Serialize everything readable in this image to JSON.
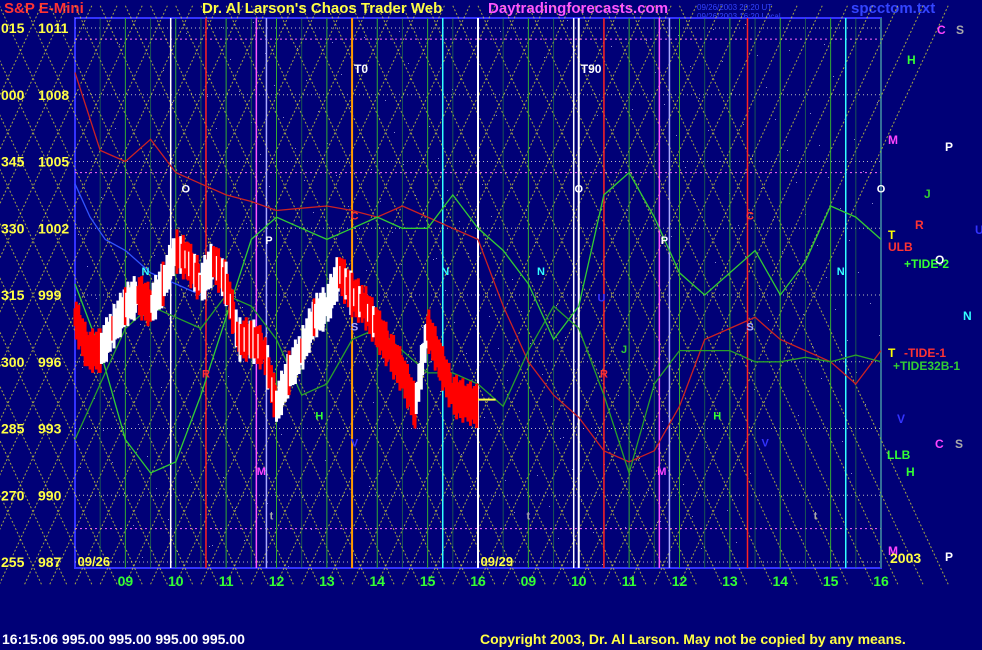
{
  "header": {
    "title": "S&P E-Mini",
    "subtitle": "Dr. Al Larson's Chaos Trader Web",
    "site": "Daytradingforecasts.com",
    "gen_line1": "09/26/2003 20:20 UT",
    "gen_line2": "09/26/2003 16:20 Local",
    "file": "spcctom.txt"
  },
  "status": {
    "last": "16:15:06  995.00 995.00 995.00 995.00",
    "copyright": "Copyright 2003, Dr. Al Larson. May not be copied by any means."
  },
  "colors": {
    "background": "#000077",
    "plot_border": "#3333ff",
    "grid_v": "#33aa33",
    "diag": "#dddd33",
    "price_up": "#ffffff",
    "price_down": "#ff0000",
    "tide": "#33cc33",
    "red_line": "#cc2222"
  },
  "chart_data": {
    "type": "line",
    "title": "S&P E-Mini",
    "ylim": [
      987,
      1011
    ],
    "y_ticks": [
      {
        "angle": "015",
        "price": "1011",
        "value": 1011
      },
      {
        "angle": "000",
        "price": "1008",
        "value": 1008
      },
      {
        "angle": "345",
        "price": "1005",
        "value": 1005
      },
      {
        "angle": "330",
        "price": "1002",
        "value": 1002
      },
      {
        "angle": "315",
        "price": "999",
        "value": 999
      },
      {
        "angle": "300",
        "price": "996",
        "value": 996
      },
      {
        "angle": "285",
        "price": "993",
        "value": 993
      },
      {
        "angle": "270",
        "price": "990",
        "value": 990
      },
      {
        "angle": "255",
        "price": "987",
        "value": 987
      }
    ],
    "dates": [
      "09/26",
      "09/29"
    ],
    "year": "2003",
    "hour_ticks": [
      {
        "label": "09",
        "x": 9.0
      },
      {
        "label": "10",
        "x": 10.0
      },
      {
        "label": "11",
        "x": 11.0
      },
      {
        "label": "12",
        "x": 12.0
      },
      {
        "label": "13",
        "x": 13.0
      },
      {
        "label": "14",
        "x": 14.0
      },
      {
        "label": "15",
        "x": 15.0
      },
      {
        "label": "16",
        "x": 16.0
      },
      {
        "label": "09",
        "x": 17.0
      },
      {
        "label": "10",
        "x": 18.0
      },
      {
        "label": "11",
        "x": 19.0
      },
      {
        "label": "12",
        "x": 20.0
      },
      {
        "label": "13",
        "x": 21.0
      },
      {
        "label": "14",
        "x": 22.0
      },
      {
        "label": "15",
        "x": 23.0
      },
      {
        "label": "16",
        "x": 24.0
      }
    ],
    "xlim": [
      8.0,
      24.0
    ],
    "special_lines": [
      {
        "label": "T0",
        "x": 13.5,
        "color": "#ff9900"
      },
      {
        "label": "T90",
        "x": 18.0,
        "color": "#ffffff"
      }
    ],
    "markers": [
      {
        "t": "O",
        "x": 10.2,
        "y": 1003.6,
        "c": "#ffffff"
      },
      {
        "t": "O",
        "x": 18.0,
        "y": 1003.6,
        "c": "#ffffff"
      },
      {
        "t": "O",
        "x": 24.0,
        "y": 1003.6,
        "c": "#ffffff"
      },
      {
        "t": "N",
        "x": 9.4,
        "y": 999.9,
        "c": "#33ffff"
      },
      {
        "t": "N",
        "x": 15.35,
        "y": 999.9,
        "c": "#33ffff"
      },
      {
        "t": "N",
        "x": 17.25,
        "y": 999.9,
        "c": "#33ffff"
      },
      {
        "t": "N",
        "x": 23.2,
        "y": 999.9,
        "c": "#33ffff"
      },
      {
        "t": "P",
        "x": 11.85,
        "y": 1001.3,
        "c": "#ffffff"
      },
      {
        "t": "P",
        "x": 19.7,
        "y": 1001.3,
        "c": "#ffffff"
      },
      {
        "t": "C",
        "x": 13.55,
        "y": 1002.4,
        "c": "#ff3333"
      },
      {
        "t": "C",
        "x": 21.4,
        "y": 1002.4,
        "c": "#ff3333"
      },
      {
        "t": "S",
        "x": 13.55,
        "y": 997.4,
        "c": "#aaaaff"
      },
      {
        "t": "S",
        "x": 21.4,
        "y": 997.4,
        "c": "#aaaaff"
      },
      {
        "t": "H",
        "x": 12.85,
        "y": 993.4,
        "c": "#33ff33"
      },
      {
        "t": "H",
        "x": 20.75,
        "y": 993.4,
        "c": "#33ff33"
      },
      {
        "t": "M",
        "x": 11.7,
        "y": 990.9,
        "c": "#ff44ff"
      },
      {
        "t": "M",
        "x": 19.65,
        "y": 990.9,
        "c": "#ff44ff"
      },
      {
        "t": "t",
        "x": 11.9,
        "y": 988.9,
        "c": "#aaaaaa"
      },
      {
        "t": "t",
        "x": 17.0,
        "y": 988.9,
        "c": "#aaaaaa"
      },
      {
        "t": "t",
        "x": 22.7,
        "y": 988.9,
        "c": "#aaaaaa"
      },
      {
        "t": "V",
        "x": 13.55,
        "y": 992.2,
        "c": "#3333ff"
      },
      {
        "t": "V",
        "x": 21.7,
        "y": 992.2,
        "c": "#3333ff"
      },
      {
        "t": "R",
        "x": 10.6,
        "y": 995.3,
        "c": "#ff3333"
      },
      {
        "t": "R",
        "x": 18.5,
        "y": 995.3,
        "c": "#ff3333"
      },
      {
        "t": "U",
        "x": 18.45,
        "y": 998.7,
        "c": "#3333ff"
      },
      {
        "t": "J",
        "x": 18.9,
        "y": 996.4,
        "c": "#33cc33"
      }
    ],
    "right_labels": [
      {
        "t": "C",
        "x": 937,
        "y": 23,
        "c": "#ff44ff"
      },
      {
        "t": "S",
        "x": 956,
        "y": 23,
        "c": "#aaaaaa"
      },
      {
        "t": "H",
        "x": 907,
        "y": 53,
        "c": "#33ff33"
      },
      {
        "t": "M",
        "x": 888,
        "y": 133,
        "c": "#ff44ff"
      },
      {
        "t": "P",
        "x": 945,
        "y": 140,
        "c": "#ffffff"
      },
      {
        "t": "J",
        "x": 924,
        "y": 187,
        "c": "#33cc33"
      },
      {
        "t": "R",
        "x": 915,
        "y": 218,
        "c": "#ff3333"
      },
      {
        "t": "U",
        "x": 975,
        "y": 223,
        "c": "#3333ff"
      },
      {
        "t": "T",
        "x": 888,
        "y": 228,
        "c": "#ffff00"
      },
      {
        "t": "ULB",
        "x": 888,
        "y": 240,
        "c": "#ff3333"
      },
      {
        "t": "O",
        "x": 935,
        "y": 253,
        "c": "#ffffff"
      },
      {
        "t": "+TIDE-2",
        "x": 904,
        "y": 257,
        "c": "#33ff33"
      },
      {
        "t": "N",
        "x": 963,
        "y": 309,
        "c": "#33ffff"
      },
      {
        "t": "T",
        "x": 888,
        "y": 346,
        "c": "#ffff00"
      },
      {
        "t": "-TIDE-1",
        "x": 904,
        "y": 346,
        "c": "#ff3333"
      },
      {
        "t": "+TIDE32B-1",
        "x": 893,
        "y": 359,
        "c": "#33cc33"
      },
      {
        "t": "V",
        "x": 897,
        "y": 412,
        "c": "#3333ff"
      },
      {
        "t": "C",
        "x": 935,
        "y": 437,
        "c": "#ff44ff"
      },
      {
        "t": "S",
        "x": 955,
        "y": 437,
        "c": "#aaaaaa"
      },
      {
        "t": "LLB",
        "x": 887,
        "y": 448,
        "c": "#33ff33"
      },
      {
        "t": "H",
        "x": 906,
        "y": 465,
        "c": "#33ff33"
      },
      {
        "t": "M",
        "x": 888,
        "y": 544,
        "c": "#ff44ff"
      },
      {
        "t": "P",
        "x": 945,
        "y": 550,
        "c": "#ffffff"
      }
    ],
    "series": [
      {
        "name": "TIDE-1",
        "color": "#cc2222",
        "x": [
          8.0,
          8.5,
          9.0,
          9.5,
          10.0,
          10.5,
          11.0,
          11.5,
          12.0,
          12.5,
          13.0,
          13.5,
          14.0,
          14.5,
          15.0,
          15.5,
          16.0,
          16.5,
          17.0,
          17.5,
          18.0,
          18.5,
          19.0,
          19.5,
          20.0,
          20.5,
          21.0,
          21.5,
          22.0,
          22.5,
          23.0,
          23.5,
          24.0
        ],
        "y": [
          1009,
          1005.5,
          1005,
          1006,
          1004.5,
          1004,
          1003.5,
          1003.2,
          1002.8,
          1002.9,
          1003,
          1002.8,
          1002.5,
          1003,
          1002.5,
          1002,
          1001.5,
          998.5,
          996,
          994.5,
          993.5,
          992,
          991.5,
          992,
          994,
          997,
          997.5,
          998,
          997,
          996.5,
          996,
          995,
          996.5
        ]
      },
      {
        "name": "TIDE-2",
        "color": "#33cc33",
        "x": [
          8.0,
          8.5,
          9.0,
          9.5,
          10.0,
          10.5,
          11.0,
          11.5,
          12.0,
          12.5,
          13.0,
          13.5,
          14.0,
          14.5,
          15.0,
          15.5,
          16.0,
          16.5,
          17.0,
          17.5,
          18.0,
          18.5,
          19.0,
          19.5,
          20.0,
          20.5,
          21.0,
          21.5,
          22.0,
          22.5,
          23.0,
          23.5,
          24.0
        ],
        "y": [
          999.5,
          996.5,
          992.5,
          991,
          991.5,
          994.5,
          998,
          1001.5,
          1002.5,
          1002,
          1001.5,
          1002,
          1002.5,
          1002,
          1002,
          1003.5,
          1002,
          1001,
          999.5,
          997,
          998.5,
          1003.5,
          1004.5,
          1002.5,
          1000,
          999,
          1000,
          1001,
          999,
          1000.5,
          1003,
          1002.5,
          1001.5
        ]
      },
      {
        "name": "TIDE32B-1",
        "color": "#2aa02a",
        "x": [
          8.0,
          8.5,
          9.0,
          9.5,
          10.0,
          10.5,
          11.0,
          11.5,
          12.0,
          12.5,
          13.0,
          13.5,
          14.0,
          14.5,
          15.0,
          15.5,
          16.0,
          16.5,
          17.0,
          17.5,
          18.0,
          18.5,
          19.0,
          19.5,
          20.0,
          20.5,
          21.0,
          21.5,
          22.0,
          22.5,
          23.0,
          23.5,
          24.0
        ],
        "y": [
          992.5,
          995,
          997.5,
          998.5,
          998,
          997.5,
          999,
          998.5,
          997,
          994.5,
          995,
          997,
          997.5,
          996.5,
          995.5,
          995.5,
          995,
          994,
          996.5,
          998.5,
          997.5,
          994.5,
          991,
          995,
          996.5,
          996.5,
          996.5,
          996,
          996,
          996.2,
          996,
          996.3,
          996
        ]
      },
      {
        "name": "price",
        "color": "#ff0000",
        "x": [
          8.0,
          8.25,
          8.5,
          8.75,
          9.0,
          9.25,
          9.5,
          9.75,
          10.0,
          10.25,
          10.5,
          10.75,
          11.0,
          11.25,
          11.5,
          11.75,
          12.0,
          12.25,
          12.5,
          12.75,
          13.0,
          13.25,
          13.5,
          13.75,
          14.0,
          14.25,
          14.5,
          14.75,
          15.0,
          15.25,
          15.5,
          15.75,
          16.0
        ],
        "y": [
          998,
          996.5,
          996.5,
          997.5,
          998.5,
          999,
          998.5,
          999.5,
          1001,
          1000.5,
          999.5,
          1000.5,
          999.5,
          997,
          997,
          996.5,
          994,
          995.5,
          996.5,
          998,
          998.5,
          1000,
          999,
          998.5,
          997.5,
          996.5,
          995.5,
          994,
          997.5,
          996,
          994.5,
          994.2,
          994
        ]
      },
      {
        "name": "blue",
        "color": "#3355ff",
        "x": [
          8.0,
          8.3,
          8.6,
          9.0,
          9.5,
          10.0,
          10.5
        ],
        "y": [
          1004,
          1002.5,
          1001.5,
          1001,
          1000,
          999.5,
          999
        ]
      }
    ]
  }
}
